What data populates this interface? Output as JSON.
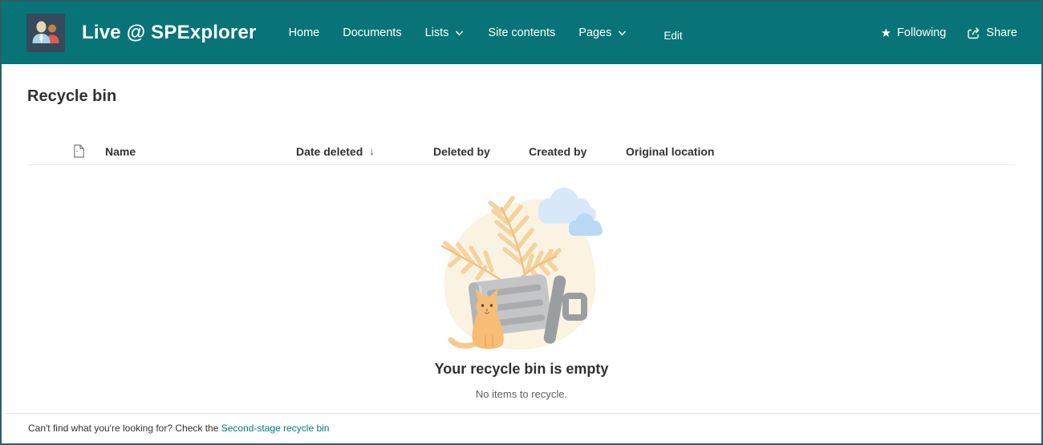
{
  "colors": {
    "header_background": "#087478",
    "logo_background": "#37495c",
    "accent_teal": "#03787c",
    "text_primary": "#323130",
    "text_muted": "#605e5c"
  },
  "header": {
    "site_title": "Live @ SPExplorer",
    "logo_icon": "two-people-icon",
    "nav": [
      {
        "label": "Home",
        "has_dropdown": false
      },
      {
        "label": "Documents",
        "has_dropdown": false
      },
      {
        "label": "Lists",
        "has_dropdown": true
      },
      {
        "label": "Site contents",
        "has_dropdown": false
      },
      {
        "label": "Pages",
        "has_dropdown": true
      },
      {
        "label": "Edit",
        "has_dropdown": false
      }
    ],
    "actions": {
      "following_icon": "star-icon",
      "following_label": "Following",
      "share_icon": "share-icon",
      "share_label": "Share"
    }
  },
  "page": {
    "title": "Recycle bin",
    "table": {
      "file_icon": "document-icon",
      "columns": [
        "Name",
        "Date deleted",
        "Deleted by",
        "Created by",
        "Original location"
      ],
      "sort": {
        "column": "Date deleted",
        "direction": "descending",
        "arrow": "↓"
      },
      "rows": []
    },
    "empty_state": {
      "illustration": "trash-can-cat-clouds-illustration",
      "title": "Your recycle bin is empty",
      "subtitle": "No items to recycle."
    },
    "footer": {
      "text": "Can't find what you're looking for? Check the ",
      "link_label": "Second-stage recycle bin"
    }
  }
}
